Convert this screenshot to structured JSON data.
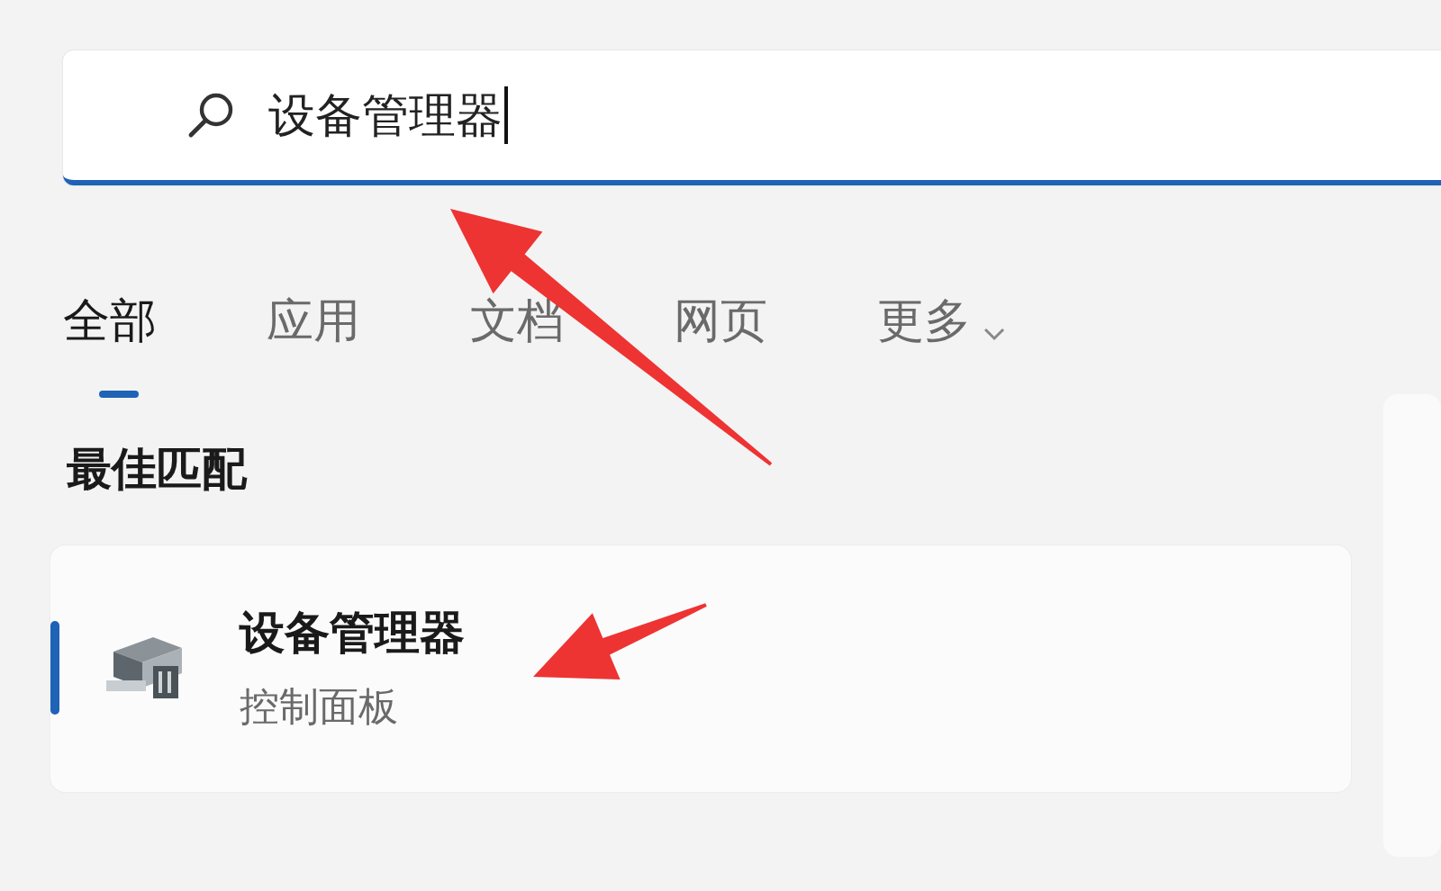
{
  "search": {
    "value": "设备管理器",
    "focused": true
  },
  "tabs": [
    {
      "label": "全部",
      "selected": true,
      "dropdown": false
    },
    {
      "label": "应用",
      "selected": false,
      "dropdown": false
    },
    {
      "label": "文档",
      "selected": false,
      "dropdown": false
    },
    {
      "label": "网页",
      "selected": false,
      "dropdown": false
    },
    {
      "label": "更多",
      "selected": false,
      "dropdown": true
    }
  ],
  "best_match": {
    "heading": "最佳匹配",
    "results": [
      {
        "title": "设备管理器",
        "subtitle": "控制面板",
        "selected": true
      }
    ]
  }
}
